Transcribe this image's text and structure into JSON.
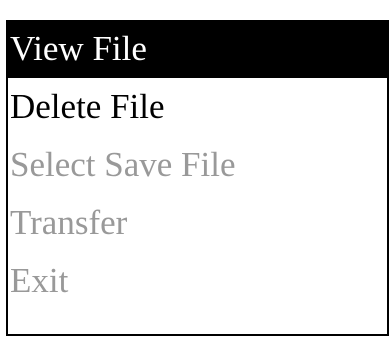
{
  "menu": {
    "items": [
      {
        "label": "View File",
        "state": "selected"
      },
      {
        "label": "Delete File",
        "state": "enabled"
      },
      {
        "label": "Select Save File",
        "state": "disabled"
      },
      {
        "label": "Transfer",
        "state": "disabled"
      },
      {
        "label": "Exit",
        "state": "disabled"
      }
    ]
  },
  "colors": {
    "selected_bg": "#000000",
    "selected_text": "#ffffff",
    "enabled_text": "#000000",
    "disabled_text": "#999999",
    "border": "#000000"
  }
}
